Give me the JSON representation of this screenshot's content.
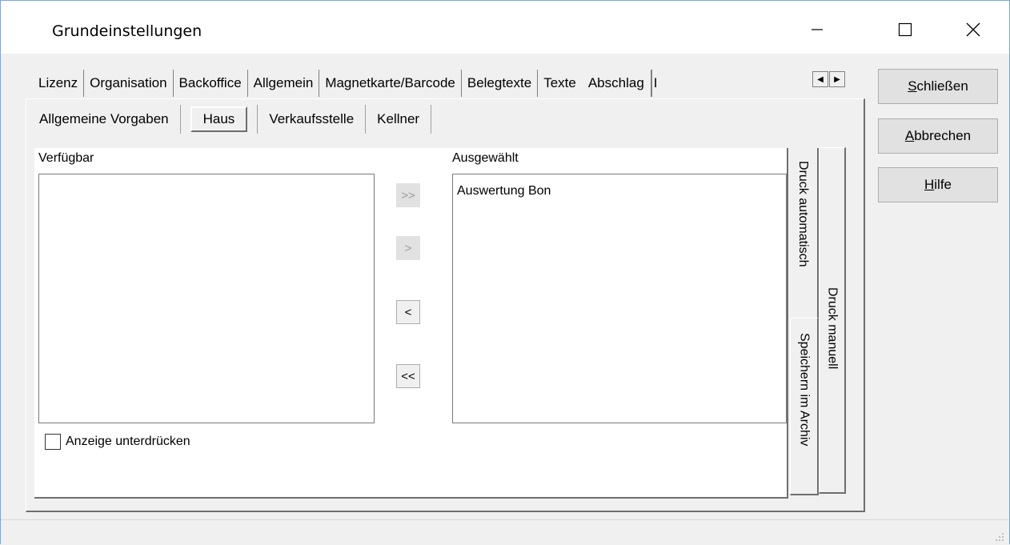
{
  "window": {
    "title": "Grundeinstellungen"
  },
  "outer_tabs": [
    {
      "label": "Lizenz"
    },
    {
      "label": "Organisation"
    },
    {
      "label": "Backoffice"
    },
    {
      "label": "Allgemein"
    },
    {
      "label": "Magnetkarte/Barcode"
    },
    {
      "label": "Belegtexte"
    },
    {
      "label": "Texte"
    },
    {
      "label": "Abschlag",
      "active": true
    },
    {
      "label": "I"
    }
  ],
  "inner_tabs": [
    {
      "label": "Allgemeine Vorgaben"
    },
    {
      "label": "Haus",
      "active": true
    },
    {
      "label": "Verkaufsstelle"
    },
    {
      "label": "Kellner"
    }
  ],
  "available": {
    "label": "Verfügbar",
    "items": []
  },
  "selected": {
    "label": "Ausgewählt",
    "items": [
      "Auswertung Bon"
    ]
  },
  "move_buttons": {
    "add_all": ">>",
    "add": ">",
    "remove": "<",
    "remove_all": "<<"
  },
  "checkbox": {
    "label": "Anzeige unterdrücken",
    "checked": false
  },
  "vertical_tabs": {
    "druck_automatisch": "Druck automatisch",
    "speichern_archiv": "Speichern im Archiv",
    "druck_manuell": "Druck manuell"
  },
  "buttons": {
    "close": {
      "accel": "S",
      "rest": "chließen"
    },
    "cancel": {
      "accel": "A",
      "rest": "bbrechen"
    },
    "help": {
      "accel": "H",
      "rest": "ilfe"
    }
  },
  "icons": {
    "minimize": "minimize-icon",
    "maximize": "maximize-icon",
    "close": "close-icon"
  }
}
